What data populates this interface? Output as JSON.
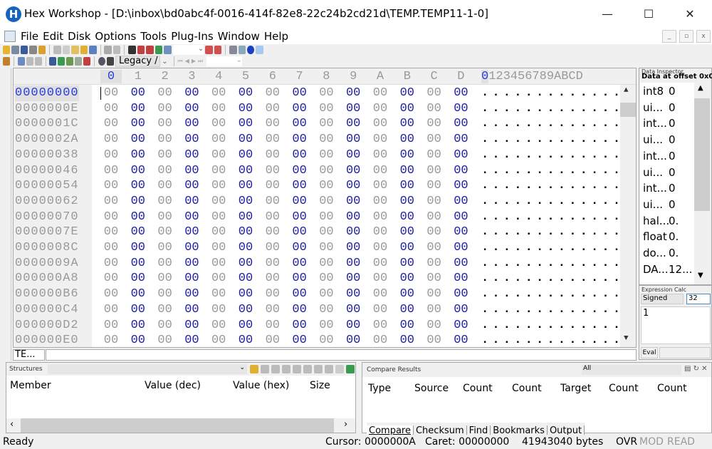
{
  "window": {
    "title": "Hex Workshop - [D:\\inbox\\bd0abc4f-0016-414f-82e8-22c24b2cd21d\\TEMP.TEMP11-1-0]",
    "app_icon_letter": "H",
    "minimize": "—",
    "maximize": "☐",
    "close": "✕"
  },
  "menu": [
    "File",
    "Edit",
    "Disk",
    "Options",
    "Tools",
    "Plug-Ins",
    "Window",
    "Help"
  ],
  "mdi": {
    "minimize": "_",
    "restore": "▫",
    "close": "x"
  },
  "toolbar": {
    "legacy_select": "Legacy /"
  },
  "hex": {
    "col_headers": [
      "0",
      "1",
      "2",
      "3",
      "4",
      "5",
      "6",
      "7",
      "8",
      "9",
      "A",
      "B",
      "C",
      "D"
    ],
    "ascii_header": "0123456789ABCDEF",
    "ascii_header_text": "0123456789ABCD",
    "rows": [
      {
        "offset": "00000000",
        "bytes": [
          "00",
          "00",
          "00",
          "00",
          "00",
          "00",
          "00",
          "00",
          "00",
          "00",
          "00",
          "00",
          "00",
          "00"
        ],
        "ascii": ".............."
      },
      {
        "offset": "0000000E",
        "bytes": [
          "00",
          "00",
          "00",
          "00",
          "00",
          "00",
          "00",
          "00",
          "00",
          "00",
          "00",
          "00",
          "00",
          "00"
        ],
        "ascii": ".............."
      },
      {
        "offset": "0000001C",
        "bytes": [
          "00",
          "00",
          "00",
          "00",
          "00",
          "00",
          "00",
          "00",
          "00",
          "00",
          "00",
          "00",
          "00",
          "00"
        ],
        "ascii": ".............."
      },
      {
        "offset": "0000002A",
        "bytes": [
          "00",
          "00",
          "00",
          "00",
          "00",
          "00",
          "00",
          "00",
          "00",
          "00",
          "00",
          "00",
          "00",
          "00"
        ],
        "ascii": ".............."
      },
      {
        "offset": "00000038",
        "bytes": [
          "00",
          "00",
          "00",
          "00",
          "00",
          "00",
          "00",
          "00",
          "00",
          "00",
          "00",
          "00",
          "00",
          "00"
        ],
        "ascii": ".............."
      },
      {
        "offset": "00000046",
        "bytes": [
          "00",
          "00",
          "00",
          "00",
          "00",
          "00",
          "00",
          "00",
          "00",
          "00",
          "00",
          "00",
          "00",
          "00"
        ],
        "ascii": ".............."
      },
      {
        "offset": "00000054",
        "bytes": [
          "00",
          "00",
          "00",
          "00",
          "00",
          "00",
          "00",
          "00",
          "00",
          "00",
          "00",
          "00",
          "00",
          "00"
        ],
        "ascii": ".............."
      },
      {
        "offset": "00000062",
        "bytes": [
          "00",
          "00",
          "00",
          "00",
          "00",
          "00",
          "00",
          "00",
          "00",
          "00",
          "00",
          "00",
          "00",
          "00"
        ],
        "ascii": ".............."
      },
      {
        "offset": "00000070",
        "bytes": [
          "00",
          "00",
          "00",
          "00",
          "00",
          "00",
          "00",
          "00",
          "00",
          "00",
          "00",
          "00",
          "00",
          "00"
        ],
        "ascii": ".............."
      },
      {
        "offset": "0000007E",
        "bytes": [
          "00",
          "00",
          "00",
          "00",
          "00",
          "00",
          "00",
          "00",
          "00",
          "00",
          "00",
          "00",
          "00",
          "00"
        ],
        "ascii": ".............."
      },
      {
        "offset": "0000008C",
        "bytes": [
          "00",
          "00",
          "00",
          "00",
          "00",
          "00",
          "00",
          "00",
          "00",
          "00",
          "00",
          "00",
          "00",
          "00"
        ],
        "ascii": ".............."
      },
      {
        "offset": "0000009A",
        "bytes": [
          "00",
          "00",
          "00",
          "00",
          "00",
          "00",
          "00",
          "00",
          "00",
          "00",
          "00",
          "00",
          "00",
          "00"
        ],
        "ascii": ".............."
      },
      {
        "offset": "000000A8",
        "bytes": [
          "00",
          "00",
          "00",
          "00",
          "00",
          "00",
          "00",
          "00",
          "00",
          "00",
          "00",
          "00",
          "00",
          "00"
        ],
        "ascii": ".............."
      },
      {
        "offset": "000000B6",
        "bytes": [
          "00",
          "00",
          "00",
          "00",
          "00",
          "00",
          "00",
          "00",
          "00",
          "00",
          "00",
          "00",
          "00",
          "00"
        ],
        "ascii": ".............."
      },
      {
        "offset": "000000C4",
        "bytes": [
          "00",
          "00",
          "00",
          "00",
          "00",
          "00",
          "00",
          "00",
          "00",
          "00",
          "00",
          "00",
          "00",
          "00"
        ],
        "ascii": ".............."
      },
      {
        "offset": "000000D2",
        "bytes": [
          "00",
          "00",
          "00",
          "00",
          "00",
          "00",
          "00",
          "00",
          "00",
          "00",
          "00",
          "00",
          "00",
          "00"
        ],
        "ascii": ".............."
      },
      {
        "offset": "000000E0",
        "bytes": [
          "00",
          "00",
          "00",
          "00",
          "00",
          "00",
          "00",
          "00",
          "00",
          "00",
          "00",
          "00",
          "00",
          "00"
        ],
        "ascii": ".............."
      }
    ],
    "file_tab": "TE..."
  },
  "data_inspector": {
    "title": "Data Inspector",
    "header": "Data at offset 0x0000000",
    "rows": [
      [
        "int8",
        "0"
      ],
      [
        "ui...",
        "0"
      ],
      [
        "int...",
        "0"
      ],
      [
        "ui...",
        "0"
      ],
      [
        "int...",
        "0"
      ],
      [
        "ui...",
        "0"
      ],
      [
        "int...",
        "0"
      ],
      [
        "ui...",
        "0"
      ],
      [
        "hal...",
        "0."
      ],
      [
        "float",
        "0."
      ],
      [
        "do...",
        "0."
      ],
      [
        "DA...",
        "12..."
      ]
    ]
  },
  "expression_calc": {
    "title": "Expression Calc",
    "mode": "Signed",
    "bits": "32",
    "expression": "1",
    "eval_label": "Eval"
  },
  "structures": {
    "title": "Structures",
    "columns": [
      "Member",
      "Value (dec)",
      "Value (hex)",
      "Size"
    ]
  },
  "compare": {
    "title": "Compare Results",
    "filter": "All",
    "columns": [
      "Type",
      "Source",
      "Count",
      "Count",
      "Target",
      "Count",
      "Count"
    ],
    "tabs": [
      "Compare",
      "Checksum",
      "Find",
      "Bookmarks",
      "Output"
    ]
  },
  "status": {
    "ready": "Ready",
    "cursor": "Cursor: 0000000A",
    "caret": "Caret: 00000000",
    "size": "41943040 bytes",
    "ovr": "OVR",
    "mod": "MOD",
    "read": "READ"
  },
  "colors": {
    "accent_blue": "#2a3be0",
    "byte_blue": "#2020a0",
    "byte_gray": "#999999"
  }
}
